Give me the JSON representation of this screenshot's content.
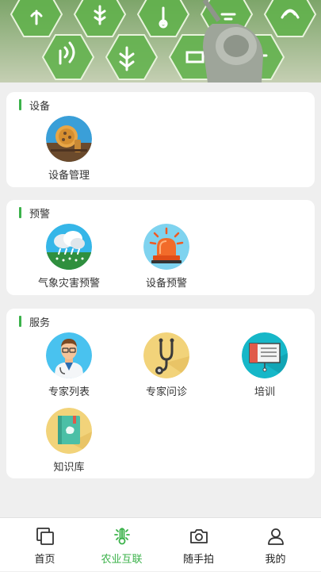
{
  "sections": {
    "device": {
      "title": "设备",
      "items": [
        {
          "label": "设备管理",
          "icon": "device-management-icon"
        }
      ]
    },
    "warning": {
      "title": "预警",
      "items": [
        {
          "label": "气象灾害预警",
          "icon": "weather-disaster-icon"
        },
        {
          "label": "设备预警",
          "icon": "alarm-light-icon"
        }
      ]
    },
    "service": {
      "title": "服务",
      "items": [
        {
          "label": "专家列表",
          "icon": "expert-doctor-icon"
        },
        {
          "label": "专家问诊",
          "icon": "stethoscope-icon"
        },
        {
          "label": "培训",
          "icon": "training-board-icon"
        },
        {
          "label": "知识库",
          "icon": "knowledge-book-icon"
        }
      ]
    }
  },
  "tabbar": {
    "items": [
      {
        "label": "首页",
        "icon": "home-pages-icon"
      },
      {
        "label": "农业互联",
        "icon": "agri-thermometer-icon"
      },
      {
        "label": "随手拍",
        "icon": "camera-icon"
      },
      {
        "label": "我的",
        "icon": "person-icon"
      }
    ],
    "active_index": 1
  },
  "colors": {
    "accent": "#3bb24a",
    "background": "#efefef",
    "card": "#ffffff"
  }
}
